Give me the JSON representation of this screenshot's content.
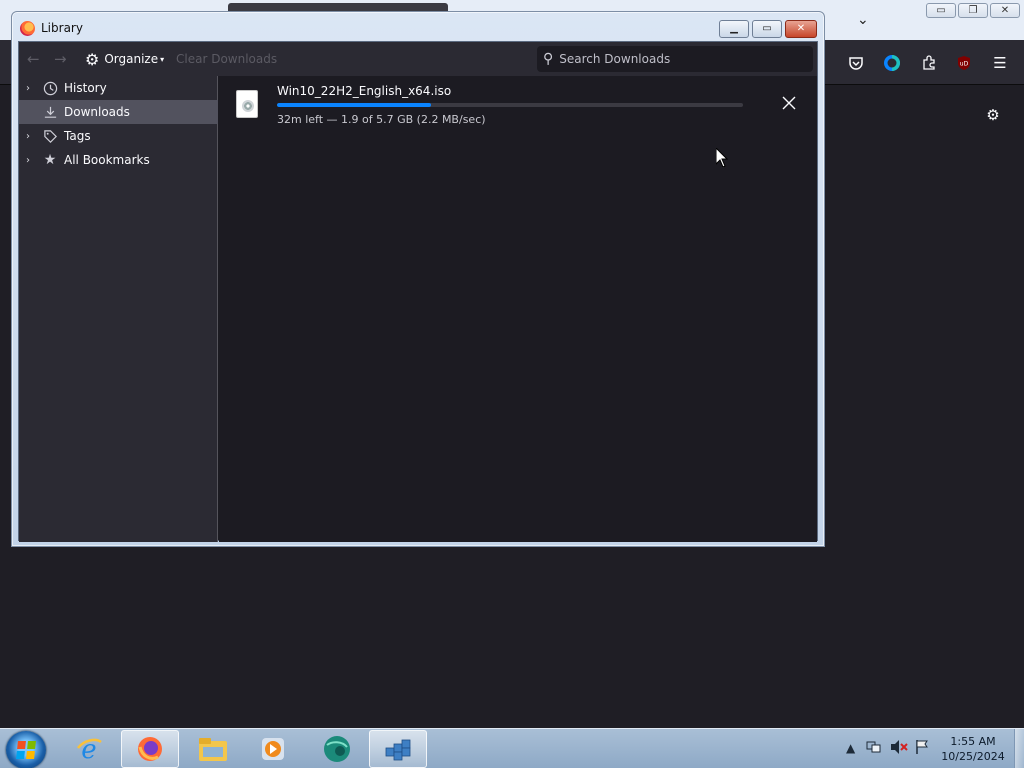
{
  "library": {
    "title": "Library",
    "toolbar": {
      "back_icon": "arrow-left-icon",
      "forward_icon": "arrow-right-icon",
      "organize_label": "Organize",
      "clear_downloads_label": "Clear Downloads",
      "search_placeholder": "Search Downloads"
    },
    "sidebar": {
      "items": [
        {
          "label": "History",
          "icon": "clock-icon",
          "expandable": true,
          "selected": false
        },
        {
          "label": "Downloads",
          "icon": "download-icon",
          "expandable": false,
          "selected": true
        },
        {
          "label": "Tags",
          "icon": "tag-icon",
          "expandable": true,
          "selected": false
        },
        {
          "label": "All Bookmarks",
          "icon": "star-icon",
          "expandable": true,
          "selected": false
        }
      ]
    },
    "downloads": [
      {
        "filename": "Win10_22H2_English_x64.iso",
        "status": "32m left — 1.9 of 5.7 GB (2.2 MB/sec)",
        "progress_fraction": 0.33,
        "icon": "disc-image-file-icon"
      }
    ]
  },
  "taskbar": {
    "clock_time": "1:55 AM",
    "clock_date": "10/25/2024",
    "pinned": [
      "internet-explorer-icon",
      "firefox-icon",
      "file-explorer-icon",
      "media-player-icon",
      "app-globe-icon",
      "registry-editor-icon"
    ]
  },
  "colors": {
    "accent": "#0a84ff",
    "dark_bg": "#1c1b22",
    "toolbar_bg": "#2b2a33",
    "selected_bg": "#52525e"
  }
}
